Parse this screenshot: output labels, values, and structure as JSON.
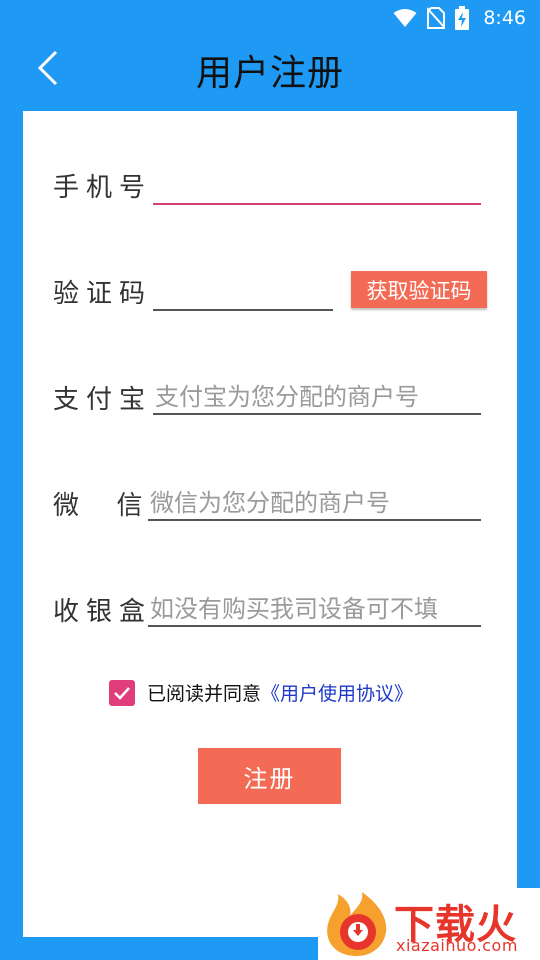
{
  "status_bar": {
    "time": "8:46",
    "icons": [
      "wifi-icon",
      "no-sim-icon",
      "battery-charging-icon"
    ]
  },
  "header": {
    "back_icon": "chevron-left-icon",
    "title": "用户注册"
  },
  "form": {
    "phone_label": "手机号",
    "code_label": "验证码",
    "get_code_button": "获取验证码",
    "alipay_label": "支付宝",
    "alipay_placeholder": "支付宝为您分配的商户号",
    "wechat_label": "微  信",
    "wechat_placeholder": "微信为您分配的商户号",
    "cashbox_label": "收银盒",
    "cashbox_placeholder": "如没有购买我司设备可不填",
    "agree_checked": true,
    "agree_text": "已阅读并同意",
    "agree_link": "《用户使用协议》",
    "submit_label": "注册"
  },
  "watermark": {
    "brand": "下载火",
    "url": "xiazaihuo.com"
  },
  "colors": {
    "background": "#1E9AF4",
    "accent_button": "#F46B55",
    "active_underline": "#D3416E",
    "checkbox": "#E13D7A",
    "link": "#1E3AC8",
    "watermark": "#E8352B"
  }
}
